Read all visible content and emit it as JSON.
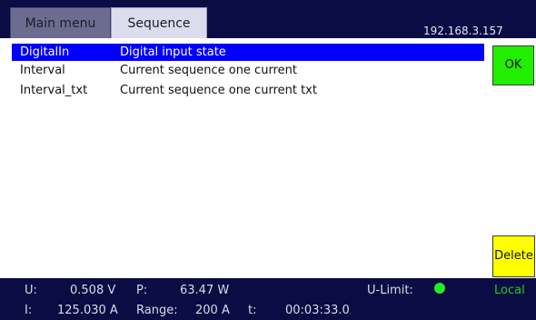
{
  "header": {
    "tabs": [
      {
        "label": "Main menu"
      },
      {
        "label": "Sequence"
      }
    ],
    "ip_address": "192.168.3.157"
  },
  "list": {
    "selected_index": 0,
    "rows": [
      {
        "name": "DigitalIn",
        "description": "Digital input state"
      },
      {
        "name": "Interval",
        "description": "Current sequence one current"
      },
      {
        "name": "Interval_txt",
        "description": "Current sequence one current txt"
      }
    ]
  },
  "buttons": {
    "ok_label": "OK",
    "delete_label": "Delete"
  },
  "status": {
    "u_label": "U:",
    "u_value": "0.508 V",
    "p_label": "P:",
    "p_value": "63.47 W",
    "u_limit_label": "U-Limit:",
    "mode": "Local",
    "i_label": "I:",
    "i_value": "125.030 A",
    "range_label": "Range:",
    "range_value": "200 A",
    "t_label": "t:",
    "t_value": "00:03:33.0"
  },
  "colors": {
    "bar_background": "#0c0c44",
    "selection": "#0000ff",
    "ok_button": "#22ee00",
    "delete_button": "#ffff00",
    "u_limit_indicator": "#22ee22",
    "local_text": "#22cc22"
  }
}
